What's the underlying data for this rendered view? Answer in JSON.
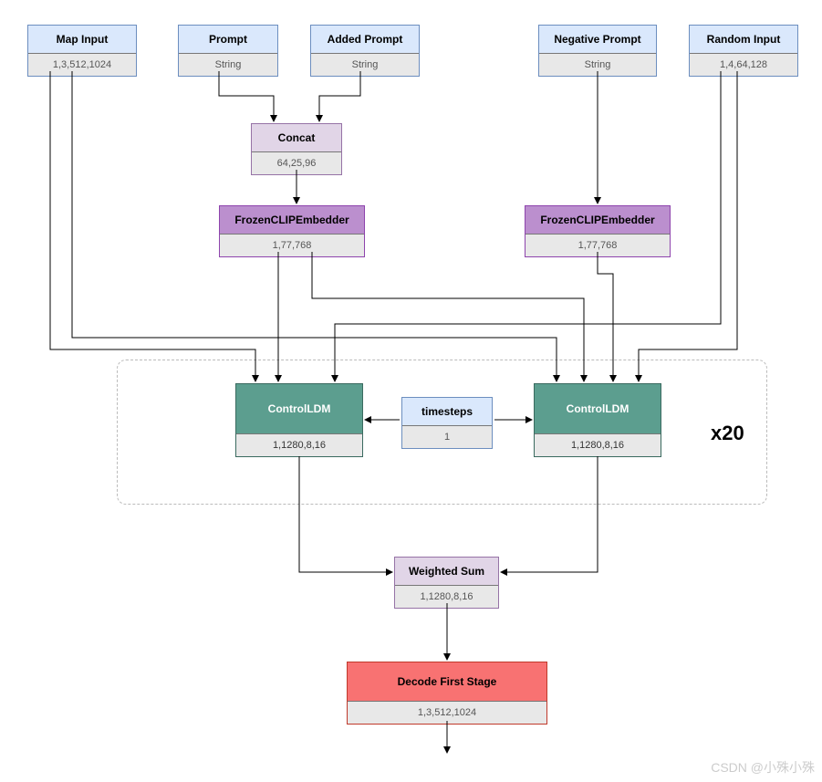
{
  "nodes": {
    "map_input": {
      "title": "Map Input",
      "sub": "1,3,512,1024"
    },
    "prompt": {
      "title": "Prompt",
      "sub": "String"
    },
    "added_prompt": {
      "title": "Added Prompt",
      "sub": "String"
    },
    "neg_prompt": {
      "title": "Negative Prompt",
      "sub": "String"
    },
    "random_input": {
      "title": "Random Input",
      "sub": "1,4,64,128"
    },
    "concat": {
      "title": "Concat",
      "sub": "64,25,96"
    },
    "clip_left": {
      "title": "FrozenCLIPEmbedder",
      "sub": "1,77,768"
    },
    "clip_right": {
      "title": "FrozenCLIPEmbedder",
      "sub": "1,77,768"
    },
    "ctrl_left": {
      "title": "ControlLDM",
      "sub": "1,1280,8,16"
    },
    "ctrl_right": {
      "title": "ControlLDM",
      "sub": "1,1280,8,16"
    },
    "timesteps": {
      "title": "timesteps",
      "sub": "1"
    },
    "wsum": {
      "title": "Weighted Sum",
      "sub": "1,1280,8,16"
    },
    "decode": {
      "title": "Decode First Stage",
      "sub": "1,3,512,1024"
    }
  },
  "loop_label": "x20",
  "watermark": "CSDN @小殊小殊"
}
